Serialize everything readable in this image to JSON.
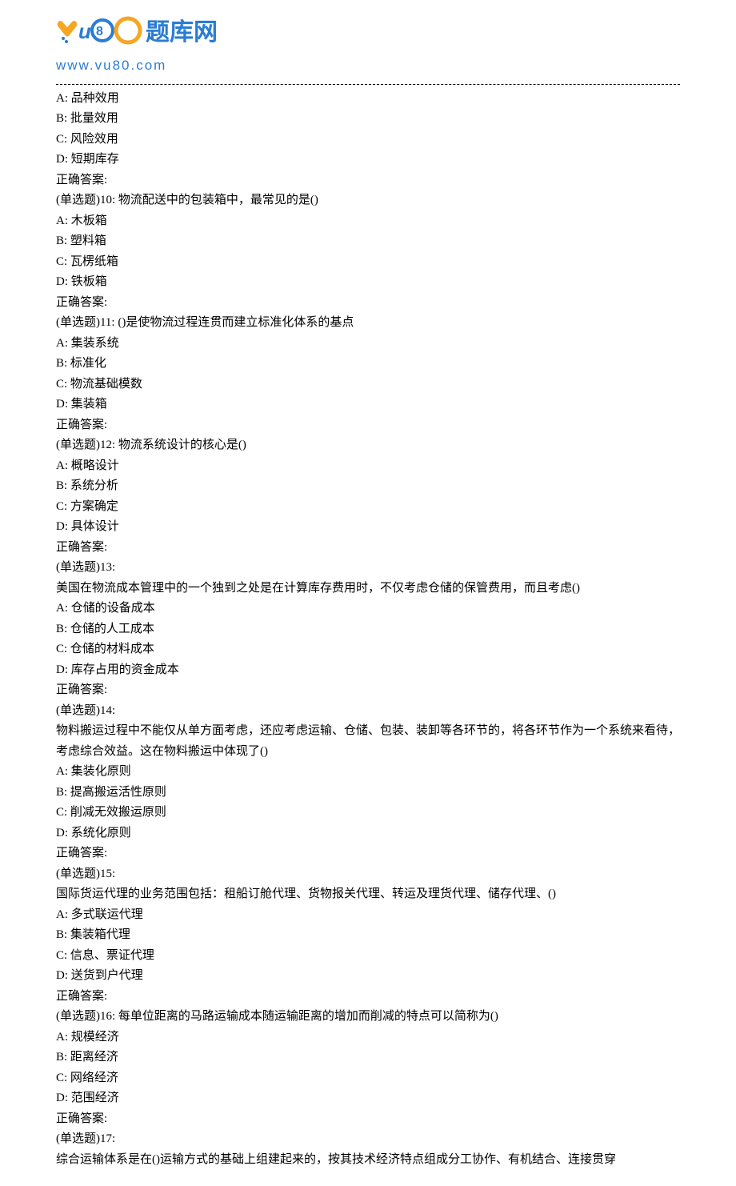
{
  "logo": {
    "main": "题库网",
    "url": "www.vu80.com"
  },
  "lines": [
    "A: 品种效用",
    "B: 批量效用",
    "C: 风险效用",
    "D: 短期库存",
    "正确答案:",
    "(单选题)10: 物流配送中的包装箱中，最常见的是()",
    "A: 木板箱",
    "B: 塑料箱",
    "C: 瓦楞纸箱",
    "D: 铁板箱",
    "正确答案:",
    "(单选题)11: ()是使物流过程连贯而建立标准化体系的基点",
    "A: 集装系统",
    "B: 标准化",
    "C: 物流基础模数",
    "D: 集装箱",
    "正确答案:",
    "(单选题)12: 物流系统设计的核心是()",
    "A: 概略设计",
    "B: 系统分析",
    "C: 方案确定",
    "D: 具体设计",
    "正确答案:",
    "(单选题)13:",
    "美国在物流成本管理中的一个独到之处是在计算库存费用时，不仅考虑仓储的保管费用，而且考虑()",
    "A: 仓储的设备成本",
    "B: 仓储的人工成本",
    "C: 仓储的材料成本",
    "D: 库存占用的资金成本",
    "正确答案:",
    "(单选题)14:",
    "物料搬运过程中不能仅从单方面考虑，还应考虑运输、仓储、包装、装卸等各环节的，将各环节作为一个系统来看待，考虑综合效益。这在物料搬运中体现了()",
    "A: 集装化原则",
    "B: 提高搬运活性原则",
    "C: 削减无效搬运原则",
    "D: 系统化原则",
    "正确答案:",
    "(单选题)15:",
    "国际货运代理的业务范围包括：租船订舱代理、货物报关代理、转运及理货代理、储存代理、()",
    "A: 多式联运代理",
    "B: 集装箱代理",
    "C: 信息、票证代理",
    "D: 送货到户代理",
    "正确答案:",
    "(单选题)16: 每单位距离的马路运输成本随运输距离的增加而削减的特点可以简称为()",
    "A: 规模经济",
    "B: 距离经济",
    "C: 网络经济",
    "D: 范围经济",
    "正确答案:",
    "(单选题)17:",
    "综合运输体系是在()运输方式的基础上组建起来的，按其技术经济特点组成分工协作、有机结合、连接贯穿"
  ]
}
